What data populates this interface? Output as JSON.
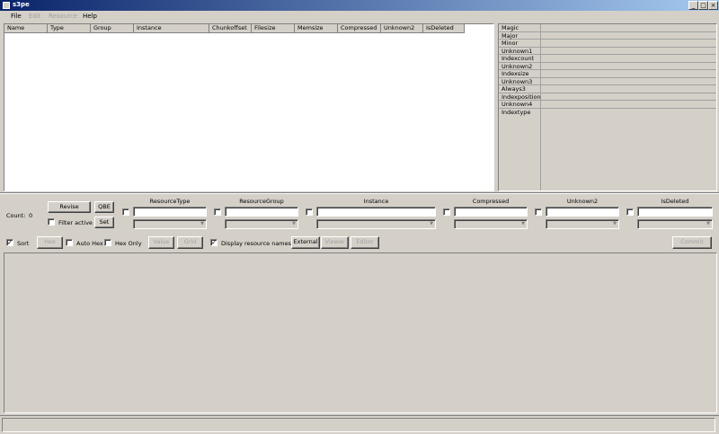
{
  "window": {
    "title": "s3pe"
  },
  "menu": {
    "file": "File",
    "edit": "Edit",
    "resource": "Resource",
    "help": "Help"
  },
  "list": {
    "columns": [
      "Name",
      "Type",
      "Group",
      "Instance",
      "Chunkoffset",
      "Filesize",
      "Memsize",
      "Compressed",
      "Unknown2",
      "IsDeleted"
    ]
  },
  "props": {
    "rows": [
      "Magic",
      "Major",
      "Minor",
      "Unknown1",
      "Indexcount",
      "Unknown2",
      "Indexsize",
      "Unknown3",
      "Always3",
      "Indexposition",
      "Unknown4",
      "Indextype"
    ]
  },
  "filter": {
    "count_label": "Count:",
    "count_value": "0",
    "revise": "Revise",
    "qbe": "QBE",
    "set": "Set",
    "filter_active": "Filter active",
    "columns": [
      "ResourceType",
      "ResourceGroup",
      "Instance",
      "Compressed",
      "Unknown2",
      "IsDeleted"
    ]
  },
  "toolbar": {
    "sort": "Sort",
    "hex": "Hex",
    "auto_hex": "Auto Hex",
    "hex_only": "Hex Only",
    "value": "Value",
    "grid": "Grid",
    "display_names": "Display resource names",
    "external": "External",
    "viewer": "Viewer",
    "editor": "Editor",
    "commit": "Commit"
  },
  "checks": {
    "sort": "✓",
    "display_names": "✓"
  },
  "icons": {
    "minimize": "minimize-icon",
    "maximize": "maximize-icon",
    "close": "close-icon",
    "app": "app-icon",
    "dropdown": "chevron-down-icon"
  }
}
